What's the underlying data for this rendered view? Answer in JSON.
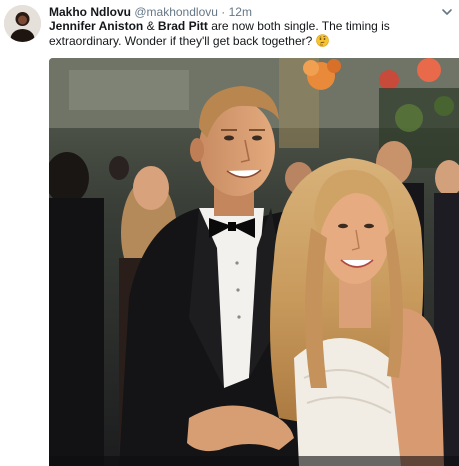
{
  "tweet": {
    "display_name": "Makho Ndlovu",
    "handle": "@makhondlovu",
    "separator": "·",
    "time": "12m",
    "text_segments": [
      "Jennifer Aniston",
      " & ",
      "Brad Pitt",
      " are now both single. The timing is extraordinary. Wonder if they'll get back together? "
    ],
    "emoji": "thinking-face",
    "icons": {
      "menu": "chevron-down-icon",
      "avatar": "avatar"
    }
  },
  "colors": {
    "name": "#14171a",
    "meta": "#657786",
    "background": "#ffffff"
  }
}
